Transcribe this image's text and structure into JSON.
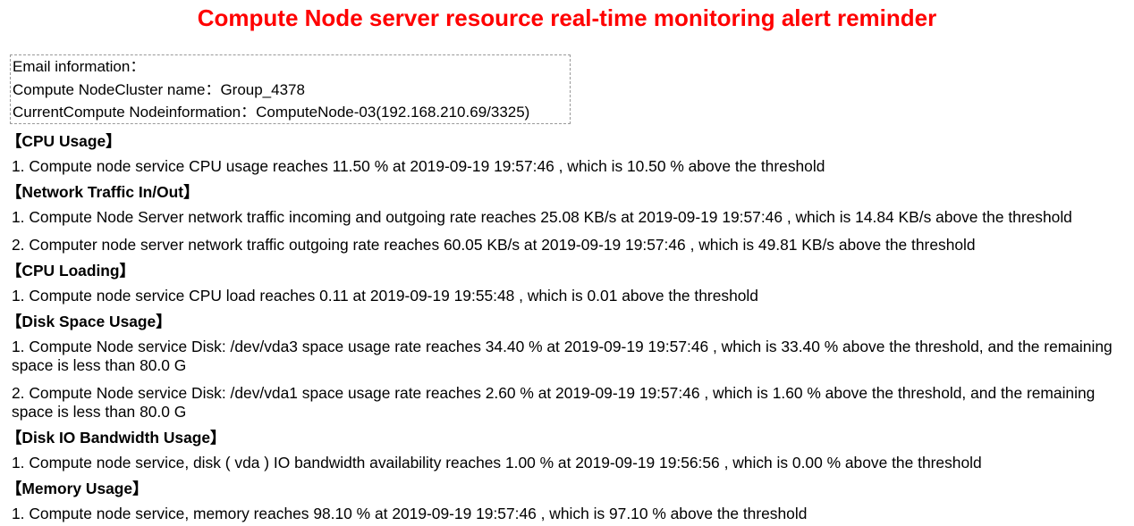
{
  "title": "Compute Node server resource real-time monitoring alert reminder",
  "info": {
    "heading": "Email information：",
    "cluster": "Compute NodeCluster name：Group_4378",
    "node": "CurrentCompute Nodeinformation：ComputeNode-03(192.168.210.69/3325)"
  },
  "sections": [
    {
      "heading": "【CPU Usage】",
      "items": [
        "1. Compute node service CPU usage reaches 11.50 % at 2019-09-19 19:57:46 , which is 10.50 % above the threshold"
      ]
    },
    {
      "heading": "【Network Traffic In/Out】",
      "items": [
        "1. Compute Node Server network traffic incoming and outgoing rate reaches 25.08 KB/s at 2019-09-19 19:57:46 , which is 14.84 KB/s above the threshold",
        "2. Computer node server network traffic outgoing rate reaches 60.05 KB/s at 2019-09-19 19:57:46 , which is 49.81 KB/s above the threshold"
      ]
    },
    {
      "heading": "【CPU Loading】",
      "items": [
        "1. Compute node service CPU load reaches 0.11 at 2019-09-19 19:55:48 , which is 0.01 above the threshold"
      ]
    },
    {
      "heading": "【Disk Space Usage】",
      "items": [
        "1. Compute Node service Disk: /dev/vda3 space usage rate reaches 34.40 % at 2019-09-19 19:57:46 , which is 33.40 % above the threshold, and the remaining space is less than 80.0 G",
        "2. Compute Node service Disk: /dev/vda1 space usage rate reaches 2.60 % at 2019-09-19 19:57:46 , which is 1.60 % above the threshold, and the remaining space is less than 80.0 G"
      ]
    },
    {
      "heading": "【Disk IO Bandwidth Usage】",
      "items": [
        "1. Compute node service, disk ( vda ) IO bandwidth availability reaches 1.00 % at 2019-09-19 19:56:56 , which is 0.00 % above the threshold"
      ]
    },
    {
      "heading": "【Memory Usage】",
      "items": [
        "1. Compute node service, memory reaches 98.10 % at 2019-09-19 19:57:46 , which is 97.10 % above the threshold"
      ]
    }
  ]
}
